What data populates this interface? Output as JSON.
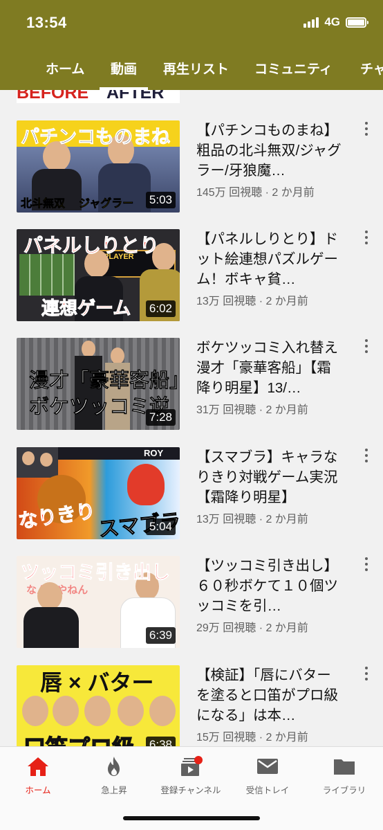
{
  "status": {
    "time": "13:54",
    "network": "4G"
  },
  "tabs": [
    "ホーム",
    "動画",
    "再生リスト",
    "コミュニティ",
    "チャ"
  ],
  "active_tab": "動画",
  "videos": [
    {
      "title": "【パチンコものまね】粗品の北斗無双/ジャグラー/牙狼魔…",
      "meta": "145万 回視聴 · 2 か月前",
      "duration": "5:03"
    },
    {
      "title": "【パネルしりとり】ドット絵連想パズルゲーム！ボキャ貧…",
      "meta": "13万 回視聴 · 2 か月前",
      "duration": "6:02"
    },
    {
      "title": "ボケツッコミ入れ替え漫才「豪華客船」【霜降り明星】13/…",
      "meta": "31万 回視聴 · 2 か月前",
      "duration": "7:28"
    },
    {
      "title": "【スマブラ】キャラなりきり対戦ゲーム実況【霜降り明星】",
      "meta": "13万 回視聴 · 2 か月前",
      "duration": "5:04"
    },
    {
      "title": "【ツッコミ引き出し】６０秒ボケて１０個ツッコミを引…",
      "meta": "29万 回視聴 · 2 か月前",
      "duration": "6:39"
    },
    {
      "title": "【検証】「唇にバターを塗ると口笛がプロ級になる」は本…",
      "meta": "15万 回視聴 · 2 か月前",
      "duration": "6:38"
    }
  ],
  "thumb_text": {
    "prev": [
      "BEFORE",
      "AFTER"
    ],
    "t1": [
      "パチンコものまね",
      "北斗無双",
      "ジャグラー"
    ],
    "t2": [
      "パネルしりとり",
      "PLAYER",
      "連想ゲーム"
    ],
    "t3": [
      "漫才「豪華客船」",
      "ボケツッコミ逆"
    ],
    "t4": [
      "なりきり",
      "スマブラ",
      "ROY"
    ],
    "t5": [
      "ツッコミ引き出し",
      "なんでやねん"
    ],
    "t6": [
      "唇 × バター",
      "口笛プロ級"
    ]
  },
  "bottom_nav": [
    {
      "label": "ホーム",
      "icon": "home-icon",
      "active": true
    },
    {
      "label": "急上昇",
      "icon": "flame-icon",
      "active": false
    },
    {
      "label": "登録チャンネル",
      "icon": "subscriptions-icon",
      "active": false
    },
    {
      "label": "受信トレイ",
      "icon": "inbox-icon",
      "active": false
    },
    {
      "label": "ライブラリ",
      "icon": "folder-icon",
      "active": false
    }
  ],
  "colors": {
    "header": "#7f7b22",
    "accent": "#e62117"
  }
}
